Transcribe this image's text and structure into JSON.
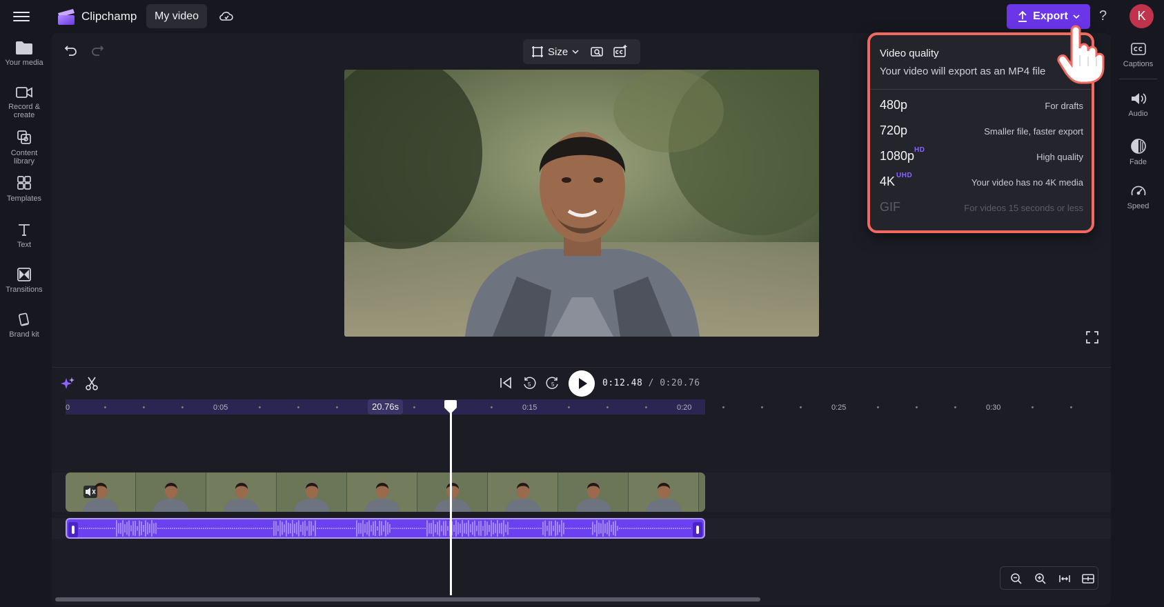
{
  "header": {
    "app_title": "Clipchamp",
    "project_name": "My video",
    "export_label": "Export",
    "help": "?",
    "avatar_initial": "K"
  },
  "left_sidebar": [
    {
      "label": "Your media",
      "icon": "folder-icon"
    },
    {
      "label": "Record &\ncreate",
      "icon": "camera-icon"
    },
    {
      "label": "Content\nlibrary",
      "icon": "library-icon"
    },
    {
      "label": "Templates",
      "icon": "templates-icon"
    },
    {
      "label": "Text",
      "icon": "text-icon"
    },
    {
      "label": "Transitions",
      "icon": "transitions-icon"
    },
    {
      "label": "Brand kit",
      "icon": "brand-kit-icon"
    }
  ],
  "right_sidebar": [
    {
      "label": "Captions",
      "icon": "captions-icon"
    },
    {
      "label": "Audio",
      "icon": "speaker-icon"
    },
    {
      "label": "Fade",
      "icon": "fade-icon"
    },
    {
      "label": "Speed",
      "icon": "speedometer-icon"
    }
  ],
  "toolbar": {
    "size_label": "Size"
  },
  "export_menu": {
    "title": "Video quality",
    "subtitle": "Your video will export as an MP4 file",
    "options": [
      {
        "resolution": "480p",
        "badge": "",
        "description": "For drafts",
        "disabled": false
      },
      {
        "resolution": "720p",
        "badge": "",
        "description": "Smaller file, faster export",
        "disabled": false
      },
      {
        "resolution": "1080p",
        "badge": "HD",
        "description": "High quality",
        "disabled": false
      },
      {
        "resolution": "4K",
        "badge": "UHD",
        "description": "Your video has no 4K media",
        "disabled": false
      },
      {
        "resolution": "GIF",
        "badge": "",
        "description": "For videos 15 seconds or less",
        "disabled": true
      }
    ]
  },
  "playback": {
    "current_time": "0:12.48",
    "total_time": "/ 0:20.76",
    "skip_back_seconds": "5",
    "skip_forward_seconds": "5"
  },
  "timeline": {
    "ruler_labels": [
      "0",
      "0:05",
      "0:15",
      "0:20",
      "0:25",
      "0:30"
    ],
    "clip_duration": "20.76s",
    "playhead_position_seconds": 12.48,
    "clip_length_seconds": 20.76
  },
  "colors": {
    "accent": "#6b35e8",
    "highlight_border": "#f2695f",
    "audio_track": "#6a40f0",
    "badge": "#8b63ff",
    "avatar": "#c0334d"
  }
}
